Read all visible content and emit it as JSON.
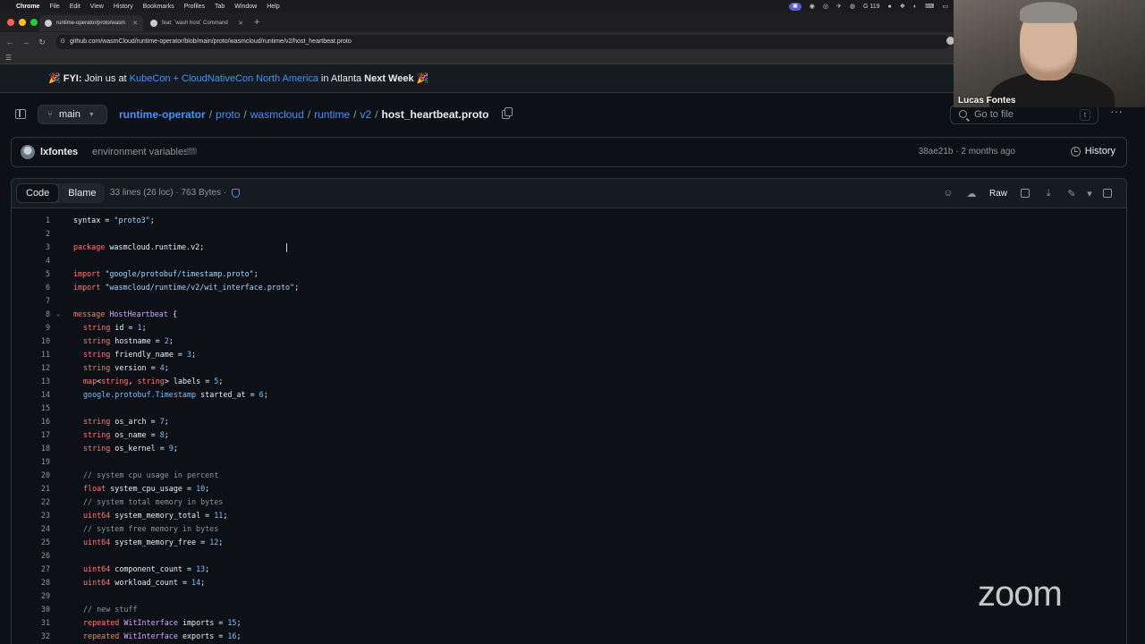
{
  "menubar": {
    "app": "Chrome",
    "items": [
      "File",
      "Edit",
      "View",
      "History",
      "Bookmarks",
      "Profiles",
      "Tab",
      "Window",
      "Help"
    ],
    "status_count": "119"
  },
  "tabs": [
    {
      "title": "runtime-operator/proto/wasm"
    },
    {
      "title": "feat: `wash host` Command"
    }
  ],
  "address": {
    "url": "github.com/wasmCloud/runtime-operator/blob/main/proto/wasmcloud/runtime/v2/host_heartbeat.proto"
  },
  "banner": {
    "prefix": "🎉 FYI:",
    "join": "Join us at",
    "link": "KubeCon + CloudNativeCon North America",
    "in": "in Atlanta",
    "next": "Next Week 🎉"
  },
  "file_header": {
    "branch": "main",
    "crumbs": [
      "runtime-operator",
      "proto",
      "wasmcloud",
      "runtime",
      "v2"
    ],
    "file": "host_heartbeat.proto",
    "goto_placeholder": "Go to file",
    "goto_key": "t"
  },
  "commit": {
    "author": "lxfontes",
    "message": "environment variables",
    "sha": "38ae21b",
    "age": "· 2 months ago",
    "history": "History"
  },
  "code_header": {
    "tab_code": "Code",
    "tab_blame": "Blame",
    "meta": "33 lines (26 loc) · 763 Bytes ·",
    "raw": "Raw"
  },
  "video": {
    "name": "Lucas Fontes"
  },
  "zoom_logo": "zoom",
  "code_lines": [
    {
      "n": "1"
    },
    {
      "n": "2"
    },
    {
      "n": "3"
    },
    {
      "n": "4"
    },
    {
      "n": "5"
    },
    {
      "n": "6"
    },
    {
      "n": "7"
    },
    {
      "n": "8"
    },
    {
      "n": "9"
    },
    {
      "n": "10"
    },
    {
      "n": "11"
    },
    {
      "n": "12"
    },
    {
      "n": "13"
    },
    {
      "n": "14"
    },
    {
      "n": "15"
    },
    {
      "n": "16"
    },
    {
      "n": "17"
    },
    {
      "n": "18"
    },
    {
      "n": "19"
    },
    {
      "n": "20"
    },
    {
      "n": "21"
    },
    {
      "n": "22"
    },
    {
      "n": "23"
    },
    {
      "n": "24"
    },
    {
      "n": "25"
    },
    {
      "n": "26"
    },
    {
      "n": "27"
    },
    {
      "n": "28"
    },
    {
      "n": "29"
    },
    {
      "n": "30"
    },
    {
      "n": "31"
    },
    {
      "n": "32"
    }
  ],
  "code": {
    "l1a": "syntax",
    "l1b": " = ",
    "l1c": "\"proto3\"",
    "l1d": ";",
    "l3a": "package",
    "l3b": " wasmcloud.runtime.v2;",
    "l5a": "import",
    "l5b": " ",
    "l5c": "\"google/protobuf/timestamp.proto\"",
    "l5d": ";",
    "l6a": "import",
    "l6b": " ",
    "l6c": "\"wasmcloud/runtime/v2/wit_interface.proto\"",
    "l6d": ";",
    "l8a": "message",
    "l8b": " ",
    "l8c": "HostHeartbeat",
    "l8d": " {",
    "string": "string",
    "float": "float",
    "uint64": "uint64",
    "repeated": "repeated",
    "map": "map",
    "l9": " id = ",
    "v1": "1",
    "l10": " hostname = ",
    "v2": "2",
    "l11": " friendly_name = ",
    "v3": "3",
    "l12": " version = ",
    "v4": "4",
    "l13a": "<",
    "l13b": ", ",
    "l13c": "> labels = ",
    "v5": "5",
    "l14a": "google.protobuf.Timestamp",
    "l14b": " started_at = ",
    "v6": "6",
    "l16": " os_arch = ",
    "v7": "7",
    "l17": " os_name = ",
    "v8": "8",
    "l18": " os_kernel = ",
    "v9": "9",
    "c20": "// system cpu usage in percent",
    "l21": " system_cpu_usage = ",
    "v10": "10",
    "c22": "// system total memory in bytes",
    "l23": " system_memory_total = ",
    "v11": "11",
    "c24": "// system free memory in bytes",
    "l25": " system_memory_free = ",
    "v12": "12",
    "l27": " component_count = ",
    "v13": "13",
    "l28": " workload_count = ",
    "v14": "14",
    "c30": "// new stuff",
    "witint": "WitInterface",
    "l31": " imports = ",
    "v15": "15",
    "l32": " exports = ",
    "v16": "16",
    "semi": ";"
  }
}
